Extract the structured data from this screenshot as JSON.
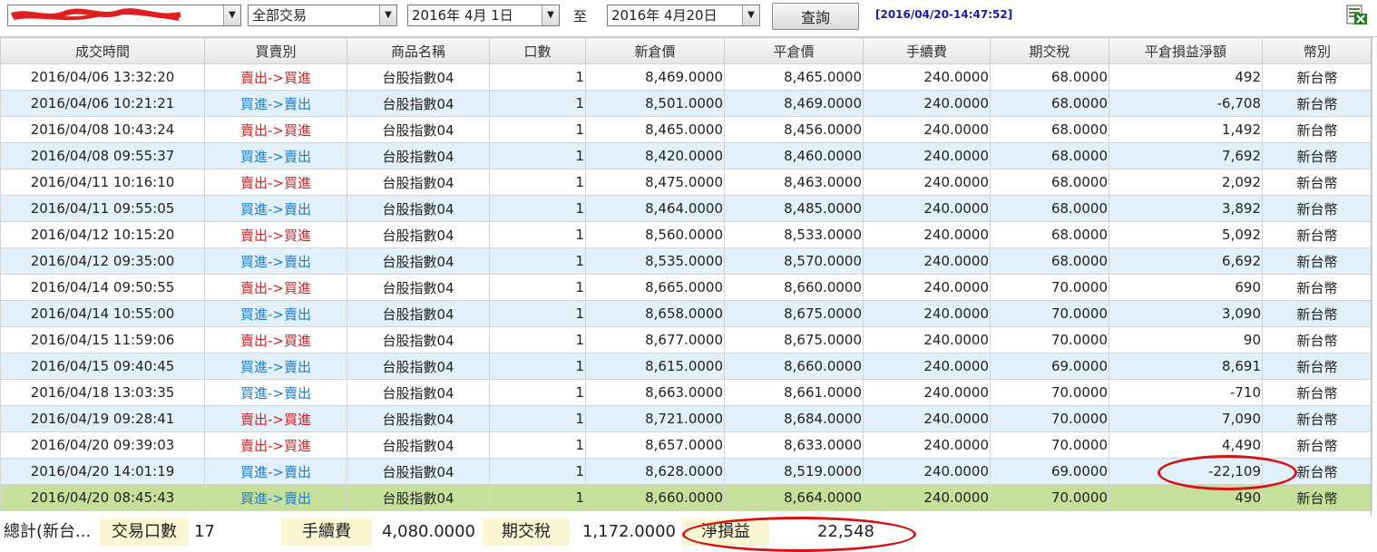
{
  "toolbar": {
    "account_select": "",
    "type_select": "全部交易",
    "date_from": "2016年  4月  1日",
    "to_label": "至",
    "date_to": "2016年  4月20日",
    "query_button": "查詢",
    "timestamp": "[2016/04/20-14:47:52]",
    "export_icon": "excel-export-icon"
  },
  "columns": [
    "成交時間",
    "買賣別",
    "商品名稱",
    "口數",
    "新倉價",
    "平倉價",
    "手續費",
    "期交稅",
    "平倉損益淨額",
    "幣別"
  ],
  "rows": [
    {
      "time": "2016/04/06 13:32:20",
      "side": "賣出->買進",
      "side_type": "sell",
      "product": "台股指數04",
      "qty": "1",
      "open": "8,469.0000",
      "close": "8,465.0000",
      "fee": "240.0000",
      "tax": "68.0000",
      "pnl": "492",
      "currency": "新台幣"
    },
    {
      "time": "2016/04/06 10:21:21",
      "side": "買進->賣出",
      "side_type": "buy",
      "product": "台股指數04",
      "qty": "1",
      "open": "8,501.0000",
      "close": "8,469.0000",
      "fee": "240.0000",
      "tax": "68.0000",
      "pnl": "-6,708",
      "currency": "新台幣"
    },
    {
      "time": "2016/04/08 10:43:24",
      "side": "賣出->買進",
      "side_type": "sell",
      "product": "台股指數04",
      "qty": "1",
      "open": "8,465.0000",
      "close": "8,456.0000",
      "fee": "240.0000",
      "tax": "68.0000",
      "pnl": "1,492",
      "currency": "新台幣"
    },
    {
      "time": "2016/04/08 09:55:37",
      "side": "買進->賣出",
      "side_type": "buy",
      "product": "台股指數04",
      "qty": "1",
      "open": "8,420.0000",
      "close": "8,460.0000",
      "fee": "240.0000",
      "tax": "68.0000",
      "pnl": "7,692",
      "currency": "新台幣"
    },
    {
      "time": "2016/04/11 10:16:10",
      "side": "賣出->買進",
      "side_type": "sell",
      "product": "台股指數04",
      "qty": "1",
      "open": "8,475.0000",
      "close": "8,463.0000",
      "fee": "240.0000",
      "tax": "68.0000",
      "pnl": "2,092",
      "currency": "新台幣"
    },
    {
      "time": "2016/04/11 09:55:05",
      "side": "買進->賣出",
      "side_type": "buy",
      "product": "台股指數04",
      "qty": "1",
      "open": "8,464.0000",
      "close": "8,485.0000",
      "fee": "240.0000",
      "tax": "68.0000",
      "pnl": "3,892",
      "currency": "新台幣"
    },
    {
      "time": "2016/04/12 10:15:20",
      "side": "賣出->買進",
      "side_type": "sell",
      "product": "台股指數04",
      "qty": "1",
      "open": "8,560.0000",
      "close": "8,533.0000",
      "fee": "240.0000",
      "tax": "68.0000",
      "pnl": "5,092",
      "currency": "新台幣"
    },
    {
      "time": "2016/04/12 09:35:00",
      "side": "買進->賣出",
      "side_type": "buy",
      "product": "台股指數04",
      "qty": "1",
      "open": "8,535.0000",
      "close": "8,570.0000",
      "fee": "240.0000",
      "tax": "68.0000",
      "pnl": "6,692",
      "currency": "新台幣"
    },
    {
      "time": "2016/04/14 09:50:55",
      "side": "賣出->買進",
      "side_type": "sell",
      "product": "台股指數04",
      "qty": "1",
      "open": "8,665.0000",
      "close": "8,660.0000",
      "fee": "240.0000",
      "tax": "70.0000",
      "pnl": "690",
      "currency": "新台幣"
    },
    {
      "time": "2016/04/14 10:55:00",
      "side": "買進->賣出",
      "side_type": "buy",
      "product": "台股指數04",
      "qty": "1",
      "open": "8,658.0000",
      "close": "8,675.0000",
      "fee": "240.0000",
      "tax": "70.0000",
      "pnl": "3,090",
      "currency": "新台幣"
    },
    {
      "time": "2016/04/15 11:59:06",
      "side": "賣出->買進",
      "side_type": "sell",
      "product": "台股指數04",
      "qty": "1",
      "open": "8,677.0000",
      "close": "8,675.0000",
      "fee": "240.0000",
      "tax": "70.0000",
      "pnl": "90",
      "currency": "新台幣"
    },
    {
      "time": "2016/04/15 09:40:45",
      "side": "買進->賣出",
      "side_type": "buy",
      "product": "台股指數04",
      "qty": "1",
      "open": "8,615.0000",
      "close": "8,660.0000",
      "fee": "240.0000",
      "tax": "69.0000",
      "pnl": "8,691",
      "currency": "新台幣"
    },
    {
      "time": "2016/04/18 13:03:35",
      "side": "買進->賣出",
      "side_type": "buy",
      "product": "台股指數04",
      "qty": "1",
      "open": "8,663.0000",
      "close": "8,661.0000",
      "fee": "240.0000",
      "tax": "70.0000",
      "pnl": "-710",
      "currency": "新台幣"
    },
    {
      "time": "2016/04/19 09:28:41",
      "side": "賣出->買進",
      "side_type": "sell",
      "product": "台股指數04",
      "qty": "1",
      "open": "8,721.0000",
      "close": "8,684.0000",
      "fee": "240.0000",
      "tax": "70.0000",
      "pnl": "7,090",
      "currency": "新台幣"
    },
    {
      "time": "2016/04/20 09:39:03",
      "side": "賣出->買進",
      "side_type": "sell",
      "product": "台股指數04",
      "qty": "1",
      "open": "8,657.0000",
      "close": "8,633.0000",
      "fee": "240.0000",
      "tax": "70.0000",
      "pnl": "4,490",
      "currency": "新台幣"
    },
    {
      "time": "2016/04/20 14:01:19",
      "side": "買進->賣出",
      "side_type": "buy",
      "product": "台股指數04",
      "qty": "1",
      "open": "8,628.0000",
      "close": "8,519.0000",
      "fee": "240.0000",
      "tax": "69.0000",
      "pnl": "-22,109",
      "currency": "新台幣"
    },
    {
      "time": "2016/04/20 08:45:43",
      "side": "買進->賣出",
      "side_type": "buy",
      "product": "台股指數04",
      "qty": "1",
      "open": "8,660.0000",
      "close": "8,664.0000",
      "fee": "240.0000",
      "tax": "70.0000",
      "pnl": "490",
      "currency": "新台幣"
    }
  ],
  "selected_row": 16,
  "footer": {
    "total_label": "總計(新台...",
    "lots_label": "交易口數",
    "lots_value": "17",
    "fee_label": "手續費",
    "fee_value": "4,080.0000",
    "tax_label": "期交稅",
    "tax_value": "1,172.0000",
    "net_label": "淨損益",
    "net_value": "22,548"
  },
  "colors": {
    "sell_text": "#c82828",
    "buy_text": "#1e7ec8",
    "row_alt": "#e2f0fb",
    "row_selected": "#c6df9a",
    "annotation_ring": "#d41414",
    "timestamp": "#1a1aa8"
  }
}
